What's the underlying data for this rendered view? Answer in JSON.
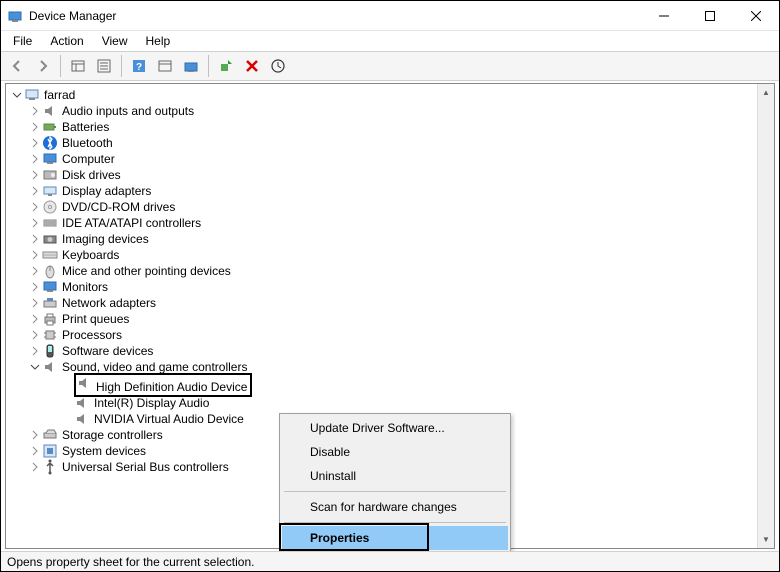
{
  "window": {
    "title": "Device Manager"
  },
  "menu": {
    "file": "File",
    "action": "Action",
    "view": "View",
    "help": "Help"
  },
  "tree": {
    "root": "farrad",
    "items": [
      "Audio inputs and outputs",
      "Batteries",
      "Bluetooth",
      "Computer",
      "Disk drives",
      "Display adapters",
      "DVD/CD-ROM drives",
      "IDE ATA/ATAPI controllers",
      "Imaging devices",
      "Keyboards",
      "Mice and other pointing devices",
      "Monitors",
      "Network adapters",
      "Print queues",
      "Processors",
      "Software devices",
      "Sound, video and game controllers",
      "Storage controllers",
      "System devices",
      "Universal Serial Bus controllers"
    ],
    "sound_children": [
      "High Definition Audio Device",
      "Intel(R) Display Audio",
      "NVIDIA Virtual Audio Device"
    ]
  },
  "context_menu": {
    "update": "Update Driver Software...",
    "disable": "Disable",
    "uninstall": "Uninstall",
    "scan": "Scan for hardware changes",
    "properties": "Properties"
  },
  "statusbar": {
    "text": "Opens property sheet for the current selection."
  }
}
